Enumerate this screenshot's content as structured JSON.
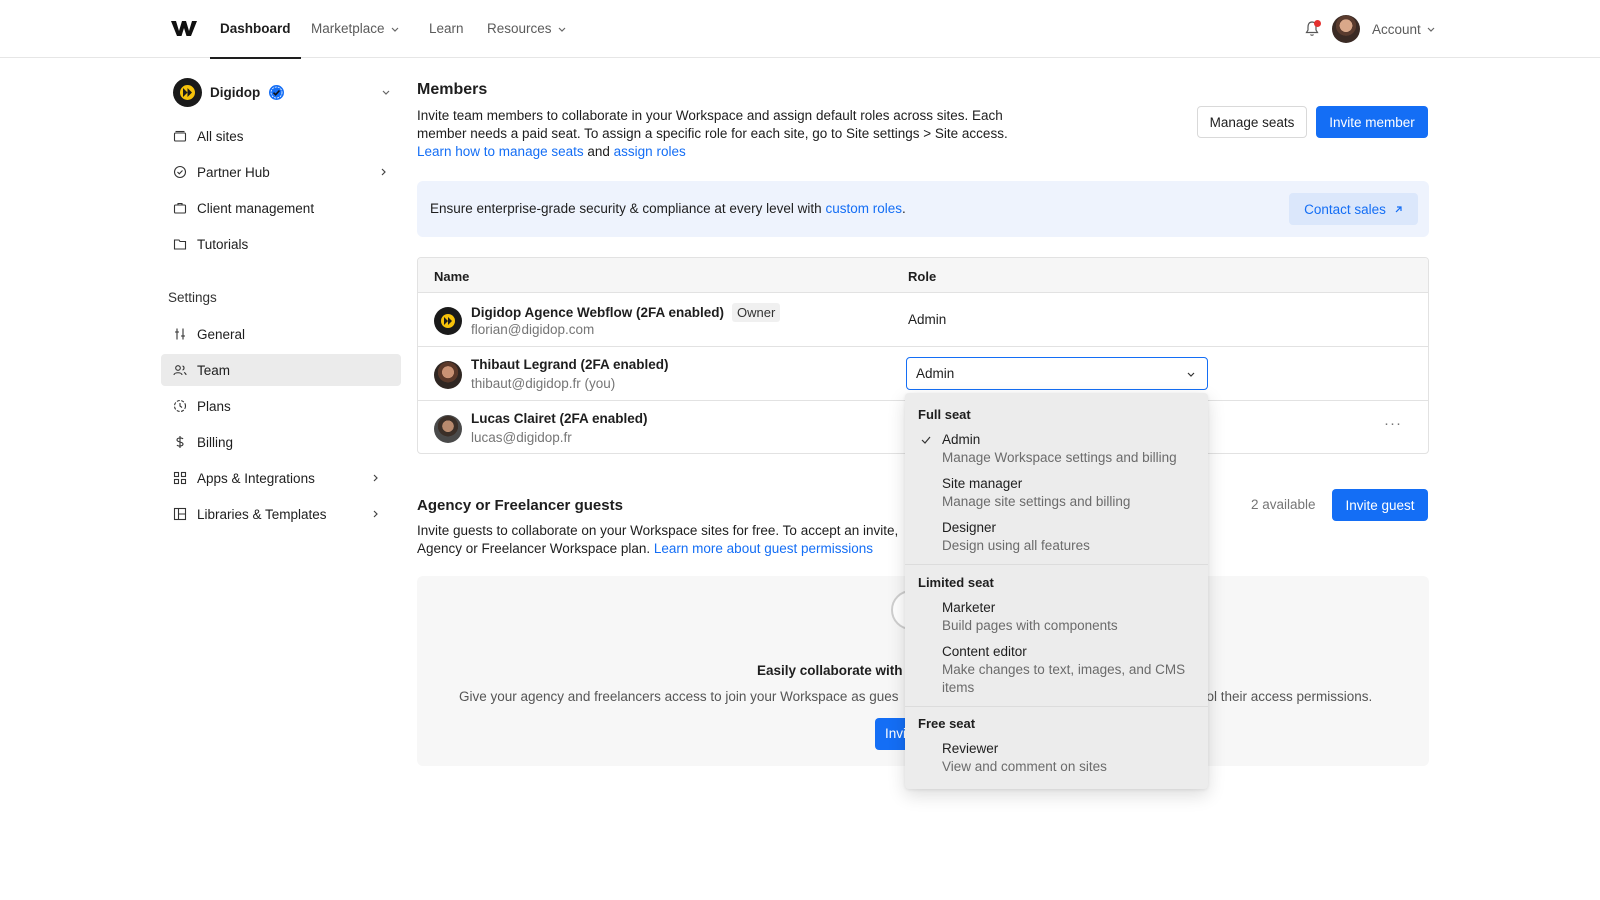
{
  "nav": {
    "items": [
      {
        "label": "Dashboard",
        "active": true
      },
      {
        "label": "Marketplace",
        "has_menu": true
      },
      {
        "label": "Learn"
      },
      {
        "label": "Resources",
        "has_menu": true
      }
    ],
    "account_label": "Account",
    "notification_dot_color": "#e5312f"
  },
  "sidebar": {
    "workspace_name": "Digidop",
    "items": [
      {
        "label": "All sites",
        "icon": "folder-icon"
      },
      {
        "label": "Partner Hub",
        "icon": "badge-icon",
        "has_arrow": true
      },
      {
        "label": "Client management",
        "icon": "briefcase-icon"
      },
      {
        "label": "Tutorials",
        "icon": "book-icon"
      }
    ],
    "settings_heading": "Settings",
    "settings_items": [
      {
        "label": "General",
        "icon": "sliders-icon"
      },
      {
        "label": "Team",
        "icon": "users-icon",
        "active": true
      },
      {
        "label": "Plans",
        "icon": "plans-icon"
      },
      {
        "label": "Billing",
        "icon": "dollar-icon"
      },
      {
        "label": "Apps & Integrations",
        "icon": "apps-icon",
        "has_arrow": true
      },
      {
        "label": "Libraries & Templates",
        "icon": "library-icon",
        "has_arrow": true
      }
    ]
  },
  "members": {
    "title": "Members",
    "desc_text": "Invite team members to collaborate in your Workspace and assign default roles across sites. Each member needs a paid seat. To assign a specific role for each site, go to Site settings > Site access.",
    "desc_link1": "Learn how to manage seats",
    "desc_and": "and",
    "desc_link2": "assign roles",
    "manage_seats": "Manage seats",
    "invite_member": "Invite member",
    "banner_text": "Ensure enterprise-grade security & compliance at every level with",
    "banner_link": "custom roles",
    "banner_period": ".",
    "contact_sales": "Contact sales",
    "table": {
      "headers": [
        "Name",
        "Role"
      ],
      "rows": [
        {
          "name": "Digidop Agence Webflow (2FA enabled)",
          "badge": "Owner",
          "email": "florian@digidop.com",
          "role": "Admin"
        },
        {
          "name": "Thibaut Legrand (2FA enabled)",
          "email": "thibaut@digidop.fr (you)",
          "role": "Admin"
        },
        {
          "name": "Lucas Clairet (2FA enabled)",
          "email": "lucas@digidop.fr",
          "more": "···"
        }
      ]
    }
  },
  "guests": {
    "title": "Agency or Freelancer guests",
    "desc_text": "Invite guests to collaborate on your Workspace sites for free. To accept an invite, Agency or Freelancer Workspace plan.",
    "desc_link": "Learn more about guest permissions",
    "available": "2 available",
    "invite_guest": "Invite guest",
    "empty_title": "Easily collaborate with y",
    "empty_desc_left": "Give your agency and freelancers access to join your Workspace as gues",
    "empty_desc_right": "rol their access permissions.",
    "empty_button": "Invi"
  },
  "role_dropdown": {
    "groups": [
      {
        "label": "Full seat",
        "options": [
          {
            "title": "Admin",
            "desc": "Manage Workspace settings and billing",
            "checked": true
          },
          {
            "title": "Site manager",
            "desc": "Manage site settings and billing"
          },
          {
            "title": "Designer",
            "desc": "Design using all features"
          }
        ]
      },
      {
        "label": "Limited seat",
        "options": [
          {
            "title": "Marketer",
            "desc": "Build pages with components"
          },
          {
            "title": "Content editor",
            "desc": "Make changes to text, images, and CMS items"
          }
        ]
      },
      {
        "label": "Free seat",
        "options": [
          {
            "title": "Reviewer",
            "desc": "View and comment on sites"
          }
        ]
      }
    ]
  },
  "colors": {
    "accent": "#146ef5",
    "banner_bg": "#eef3fd",
    "workspace_yellow": "#f6c20a"
  }
}
